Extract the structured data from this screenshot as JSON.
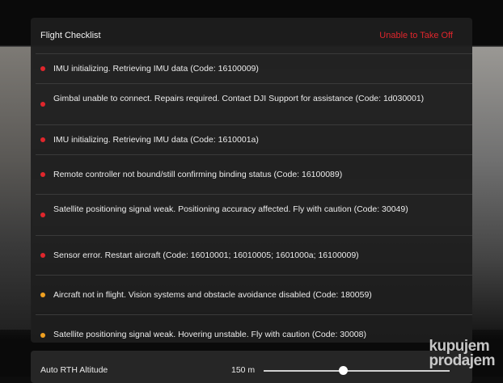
{
  "panel": {
    "title": "Flight Checklist",
    "status": "Unable to Take Off",
    "status_color": "#e0262c"
  },
  "checklist": [
    {
      "text": "IMU initializing. Retrieving IMU data (Code: 16100009)",
      "severity": "error",
      "color": "#e0262c"
    },
    {
      "text": "Gimbal unable to connect. Repairs required. Contact DJI Support for assistance (Code: 1d030001)",
      "severity": "error",
      "color": "#e0262c"
    },
    {
      "text": "IMU initializing. Retrieving IMU data (Code: 1610001a)",
      "severity": "error",
      "color": "#e0262c"
    },
    {
      "text": "Remote controller not bound/still confirming binding status (Code: 16100089)",
      "severity": "error",
      "color": "#e0262c"
    },
    {
      "text": "Satellite positioning signal weak. Positioning accuracy affected. Fly with caution (Code: 30049)",
      "severity": "error",
      "color": "#e0262c"
    },
    {
      "text": "Sensor error. Restart aircraft (Code: 16010001; 16010005; 1601000a; 16100009)",
      "severity": "error",
      "color": "#e0262c"
    },
    {
      "text": "Aircraft not in flight. Vision systems and obstacle avoidance disabled (Code: 180059)",
      "severity": "warning",
      "color": "#f0a020"
    },
    {
      "text": "Satellite positioning signal weak. Hovering unstable. Fly with caution (Code: 30008)",
      "severity": "warning",
      "color": "#f0a020"
    }
  ],
  "rth": {
    "label": "Auto RTH Altitude",
    "value": "150 m",
    "slider_fraction": 0.43
  },
  "watermark": {
    "line1": "kupujem",
    "line2": "prodajem"
  }
}
